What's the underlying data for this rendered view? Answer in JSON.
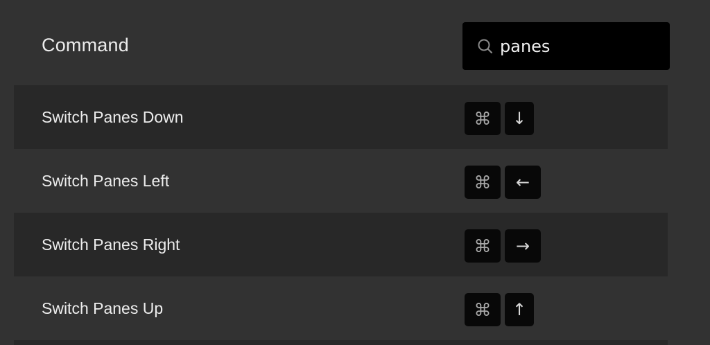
{
  "header": {
    "title": "Command",
    "search": {
      "value": "panes",
      "icon": "search-icon"
    }
  },
  "commands": [
    {
      "label": "Switch Panes Down",
      "keys": [
        "⌘",
        "↓"
      ]
    },
    {
      "label": "Switch Panes Left",
      "keys": [
        "⌘",
        "←"
      ]
    },
    {
      "label": "Switch Panes Right",
      "keys": [
        "⌘",
        "→"
      ]
    },
    {
      "label": "Switch Panes Up",
      "keys": [
        "⌘",
        "↑"
      ]
    }
  ],
  "colors": {
    "background": "#323232",
    "row_shaded": "#282828",
    "key_bg": "#080808",
    "search_bg": "#000000"
  }
}
